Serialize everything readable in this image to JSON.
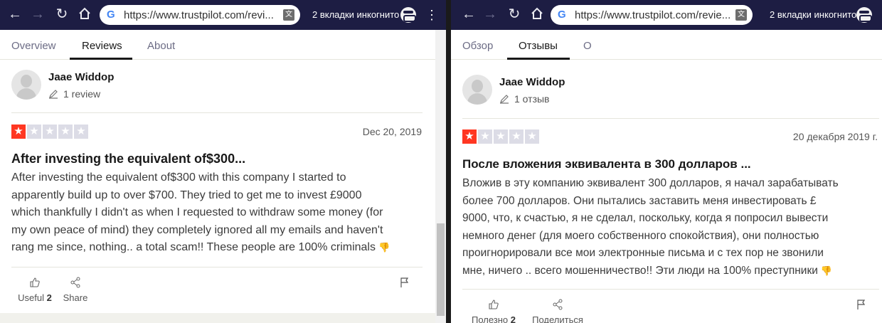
{
  "left": {
    "url": "https://www.trustpilot.com/revi...",
    "incognito": "2 вкладки инкогнито",
    "tabs": [
      "Overview",
      "Reviews",
      "About"
    ],
    "reviewer": "Jaae Widdop",
    "review_count": "1 review",
    "rating": 1,
    "date": "Dec 20, 2019",
    "title": "After investing the equivalent of$300...",
    "body_lines": [
      "After investing the equivalent of$300 with this company I started to",
      "apparently build up to over $700. They tried to get me to invest £9000",
      "which thankfully I didn't as when I requested to withdraw some money (for",
      "my own peace of mind) they completely ignored all my emails and haven't",
      "rang me since, nothing.. a total scam!! These people are 100% criminals"
    ],
    "useful_label": "Useful",
    "useful_count": "2",
    "share_label": "Share"
  },
  "right": {
    "url": "https://www.trustpilot.com/revie...",
    "incognito": "2 вкладки инкогнито",
    "tabs": [
      "Обзор",
      "Отзывы",
      "О"
    ],
    "reviewer": "Jaae Widdop",
    "review_count": "1 отзыв",
    "rating": 1,
    "date": "20 декабря 2019 г.",
    "title": "После вложения эквивалента в 300 долларов ...",
    "body_lines": [
      "Вложив в эту компанию эквивалент 300 долларов, я начал зарабатывать",
      "более 700 долларов. Они пытались заставить меня инвестировать £",
      "9000, что, к счастью, я не сделал, поскольку, когда я попросил вывести",
      "немного денег (для моего собственного спокойствия), они полностью",
      "проигнорировали все мои электронные письма и с тех пор не звонили",
      "мне, ничего .. всего мошенничество!! Эти люди на 100% преступники"
    ],
    "useful_label": "Полезно",
    "useful_count": "2",
    "share_label": "Поделиться"
  },
  "colors": {
    "toolbar": "#1d1d43",
    "star_filled": "#ff3722",
    "star_empty": "#dcdce6"
  }
}
